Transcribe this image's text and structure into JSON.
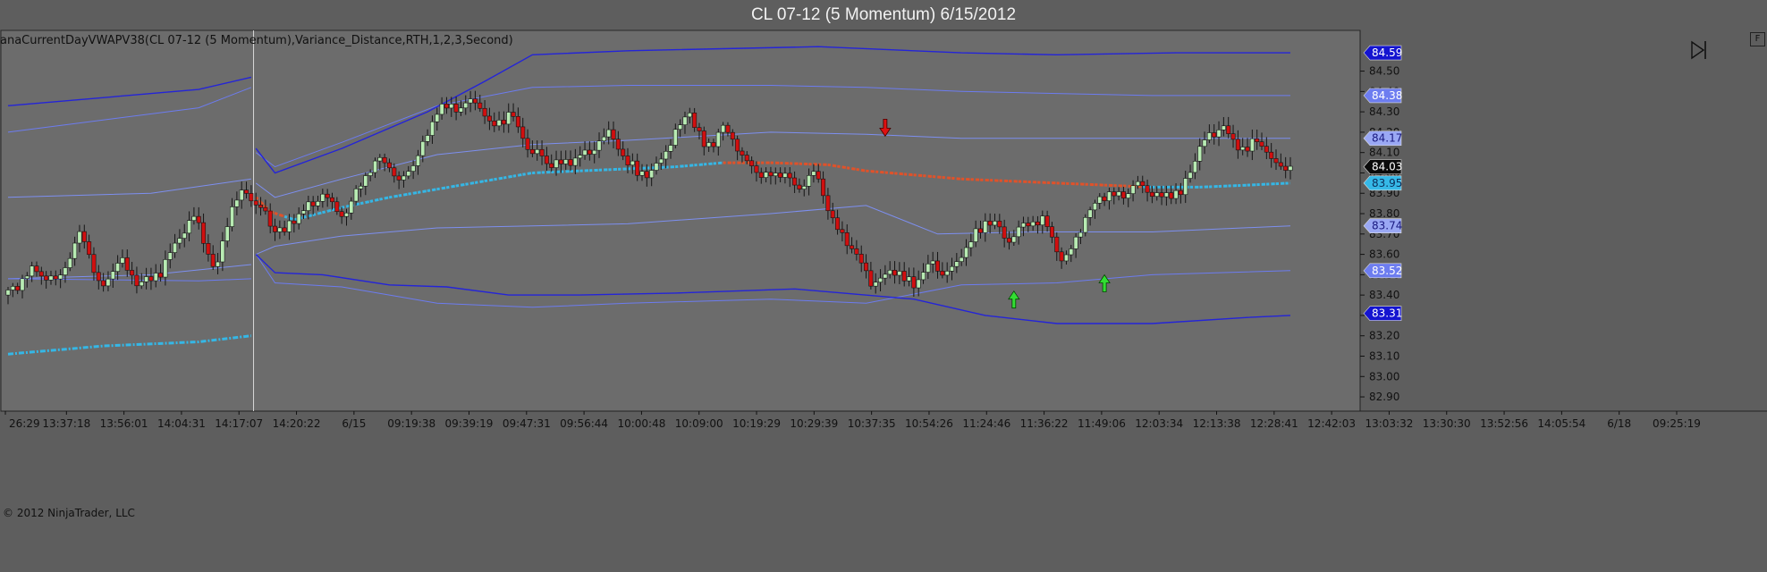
{
  "window": {
    "title": "CL 07-12 (5 Momentum)  6/15/2012"
  },
  "indicator_label": "anaCurrentDayVWAPV38(CL  07-12  (5  Momentum),Variance_Distance,RTH,1,2,3,Second)",
  "copyright": "© 2012 NinjaTrader, LLC",
  "controls": {
    "float_button": "F",
    "scroll_end_icon": "scroll-to-end-icon"
  },
  "colors": {
    "background": "#5e5e5e",
    "up_candle": "#b8ebb3",
    "down_candle": "#d10f0f",
    "vwap_up": "#35b7e6",
    "vwap_down": "#e0522a",
    "band1": "#7d8ff0",
    "band2": "#6c7cf0",
    "band3": "#2424d8",
    "buy_arrow": "#33dd33",
    "sell_arrow": "#dd1111"
  },
  "chart_data": {
    "type": "candlestick",
    "title": "CL 07-12 (5 Momentum)  6/15/2012",
    "y_axis": {
      "range": [
        82.83,
        84.7
      ],
      "ticks": [
        "84.50",
        "84.40",
        "84.30",
        "84.20",
        "84.10",
        "84.00",
        "83.90",
        "83.80",
        "83.70",
        "83.60",
        "83.50",
        "83.40",
        "83.30",
        "83.20",
        "83.10",
        "83.00",
        "82.90"
      ]
    },
    "price_tags": [
      {
        "label": "84.59",
        "value": 84.59,
        "style": "band3"
      },
      {
        "label": "84.38",
        "value": 84.38,
        "style": "band2"
      },
      {
        "label": "84.17",
        "value": 84.17,
        "style": "band1"
      },
      {
        "label": "84.03",
        "value": 84.03,
        "style": "last"
      },
      {
        "label": "83.95",
        "value": 83.95,
        "style": "vwap"
      },
      {
        "label": "83.74",
        "value": 83.74,
        "style": "band1"
      },
      {
        "label": "83.52",
        "value": 83.52,
        "style": "band2"
      },
      {
        "label": "83.31",
        "value": 83.31,
        "style": "band3"
      }
    ],
    "x_axis": {
      "ticks": [
        "26:29",
        "13:37:18",
        "13:56:01",
        "14:04:31",
        "14:17:07",
        "14:20:22",
        "6/15",
        "09:19:38",
        "09:39:19",
        "09:47:31",
        "09:56:44",
        "10:00:48",
        "10:09:00",
        "10:19:29",
        "10:29:39",
        "10:37:35",
        "10:54:26",
        "11:24:46",
        "11:36:22",
        "11:49:06",
        "12:03:34",
        "12:13:38",
        "12:28:41",
        "12:42:03",
        "13:03:32",
        "13:30:30",
        "13:52:56",
        "14:05:54",
        "6/18",
        "09:25:19"
      ]
    },
    "session_break_after_bar": 51,
    "close_path": [
      [
        0,
        83.4
      ],
      [
        6,
        83.53
      ],
      [
        11,
        83.45
      ],
      [
        16,
        83.72
      ],
      [
        20,
        83.42
      ],
      [
        24,
        83.58
      ],
      [
        28,
        83.45
      ],
      [
        33,
        83.53
      ],
      [
        36,
        83.67
      ],
      [
        40,
        83.79
      ],
      [
        44,
        83.5
      ],
      [
        47,
        83.8
      ],
      [
        50,
        83.92
      ],
      [
        54,
        83.82
      ],
      [
        57,
        83.7
      ],
      [
        60,
        83.76
      ],
      [
        64,
        83.85
      ],
      [
        67,
        83.9
      ],
      [
        71,
        83.78
      ],
      [
        75,
        83.97
      ],
      [
        79,
        84.08
      ],
      [
        83,
        83.95
      ],
      [
        87,
        84.1
      ],
      [
        91,
        84.33
      ],
      [
        95,
        84.3
      ],
      [
        99,
        84.36
      ],
      [
        102,
        84.22
      ],
      [
        106,
        84.3
      ],
      [
        109,
        84.15
      ],
      [
        113,
        84.06
      ],
      [
        118,
        84.05
      ],
      [
        123,
        84.12
      ],
      [
        127,
        84.2
      ],
      [
        131,
        84.02
      ],
      [
        135,
        83.98
      ],
      [
        139,
        84.12
      ],
      [
        143,
        84.3
      ],
      [
        147,
        84.12
      ],
      [
        151,
        84.23
      ],
      [
        155,
        84.07
      ],
      [
        159,
        83.98
      ],
      [
        163,
        84.0
      ],
      [
        166,
        83.93
      ],
      [
        170,
        84.0
      ],
      [
        174,
        83.74
      ],
      [
        178,
        83.62
      ],
      [
        182,
        83.45
      ],
      [
        187,
        83.52
      ],
      [
        190,
        83.43
      ],
      [
        194,
        83.56
      ],
      [
        198,
        83.5
      ],
      [
        202,
        83.65
      ],
      [
        206,
        83.78
      ],
      [
        210,
        83.68
      ],
      [
        214,
        83.74
      ],
      [
        218,
        83.77
      ],
      [
        222,
        83.55
      ],
      [
        226,
        83.75
      ],
      [
        230,
        83.9
      ],
      [
        234,
        83.88
      ],
      [
        238,
        83.95
      ],
      [
        243,
        83.88
      ],
      [
        247,
        83.92
      ],
      [
        251,
        84.15
      ],
      [
        255,
        84.22
      ],
      [
        259,
        84.12
      ],
      [
        263,
        84.16
      ],
      [
        266,
        84.06
      ],
      [
        269,
        84.03
      ]
    ],
    "series": [
      {
        "name": "VWAP",
        "points": [
          [
            0,
            83.11
          ],
          [
            20,
            83.15
          ],
          [
            40,
            83.17
          ],
          [
            51,
            83.2
          ],
          [
            52,
            83.88
          ],
          [
            55,
            83.81
          ],
          [
            60,
            83.77
          ],
          [
            70,
            83.83
          ],
          [
            80,
            83.88
          ],
          [
            90,
            83.92
          ],
          [
            100,
            83.96
          ],
          [
            110,
            84.0
          ],
          [
            120,
            84.01
          ],
          [
            130,
            84.02
          ],
          [
            140,
            84.03
          ],
          [
            150,
            84.05
          ],
          [
            160,
            84.05
          ],
          [
            172,
            84.04
          ],
          [
            180,
            84.01
          ],
          [
            190,
            83.99
          ],
          [
            200,
            83.97
          ],
          [
            210,
            83.96
          ],
          [
            220,
            83.95
          ],
          [
            230,
            83.94
          ],
          [
            240,
            83.93
          ],
          [
            250,
            83.93
          ],
          [
            260,
            83.94
          ],
          [
            269,
            83.95
          ]
        ],
        "color_change": [
          [
            56,
            84.4
          ],
          [
            76,
            83.86
          ],
          [
            151,
            150
          ]
        ]
      },
      {
        "name": "band1",
        "upper": [
          [
            0,
            83.88
          ],
          [
            30,
            83.9
          ],
          [
            51,
            83.97
          ],
          [
            52,
            83.95
          ],
          [
            56,
            83.88
          ],
          [
            70,
            83.97
          ],
          [
            90,
            84.09
          ],
          [
            110,
            84.14
          ],
          [
            130,
            84.16
          ],
          [
            160,
            84.2
          ],
          [
            180,
            84.19
          ],
          [
            200,
            84.17
          ],
          [
            220,
            84.17
          ],
          [
            240,
            84.17
          ],
          [
            269,
            84.17
          ]
        ],
        "lower": [
          [
            0,
            83.48
          ],
          [
            30,
            83.5
          ],
          [
            51,
            83.55
          ],
          [
            52,
            83.6
          ],
          [
            56,
            83.64
          ],
          [
            70,
            83.69
          ],
          [
            90,
            83.73
          ],
          [
            110,
            83.74
          ],
          [
            130,
            83.75
          ],
          [
            160,
            83.8
          ],
          [
            180,
            83.84
          ],
          [
            195,
            83.7
          ],
          [
            215,
            83.71
          ],
          [
            240,
            83.71
          ],
          [
            269,
            83.74
          ]
        ]
      },
      {
        "name": "band2",
        "upper": [
          [
            0,
            84.2
          ],
          [
            40,
            84.32
          ],
          [
            51,
            84.42
          ],
          [
            52,
            84.1
          ],
          [
            56,
            84.03
          ],
          [
            70,
            84.15
          ],
          [
            90,
            84.33
          ],
          [
            110,
            84.42
          ],
          [
            130,
            84.43
          ],
          [
            160,
            84.43
          ],
          [
            180,
            84.42
          ],
          [
            200,
            84.4
          ],
          [
            220,
            84.39
          ],
          [
            240,
            84.38
          ],
          [
            269,
            84.38
          ]
        ],
        "lower": [
          [
            0,
            83.48
          ],
          [
            40,
            83.47
          ],
          [
            51,
            83.48
          ],
          [
            52,
            83.6
          ],
          [
            56,
            83.46
          ],
          [
            70,
            83.44
          ],
          [
            90,
            83.36
          ],
          [
            110,
            83.34
          ],
          [
            130,
            83.36
          ],
          [
            160,
            83.38
          ],
          [
            180,
            83.36
          ],
          [
            200,
            83.45
          ],
          [
            220,
            83.46
          ],
          [
            240,
            83.5
          ],
          [
            269,
            83.52
          ]
        ]
      },
      {
        "name": "band3",
        "upper": [
          [
            0,
            84.33
          ],
          [
            40,
            84.41
          ],
          [
            51,
            84.47
          ],
          [
            52,
            84.12
          ],
          [
            56,
            84.0
          ],
          [
            70,
            84.12
          ],
          [
            88,
            84.3
          ],
          [
            100,
            84.45
          ],
          [
            110,
            84.58
          ],
          [
            130,
            84.6
          ],
          [
            170,
            84.62
          ],
          [
            190,
            84.6
          ],
          [
            200,
            84.59
          ],
          [
            220,
            84.58
          ],
          [
            245,
            84.59
          ],
          [
            269,
            84.59
          ]
        ],
        "lower": [
          [
            52,
            83.6
          ],
          [
            56,
            83.51
          ],
          [
            66,
            83.5
          ],
          [
            80,
            83.45
          ],
          [
            92,
            83.44
          ],
          [
            105,
            83.4
          ],
          [
            120,
            83.4
          ],
          [
            140,
            83.41
          ],
          [
            165,
            83.43
          ],
          [
            190,
            83.38
          ],
          [
            205,
            83.3
          ],
          [
            220,
            83.26
          ],
          [
            240,
            83.26
          ],
          [
            260,
            83.29
          ],
          [
            269,
            83.3
          ]
        ]
      }
    ],
    "markers": [
      {
        "type": "sell",
        "bar": 184,
        "price": 84.22
      },
      {
        "type": "buy",
        "bar": 211,
        "price": 83.38
      },
      {
        "type": "buy",
        "bar": 230,
        "price": 83.46
      }
    ],
    "bar_count": 270
  }
}
